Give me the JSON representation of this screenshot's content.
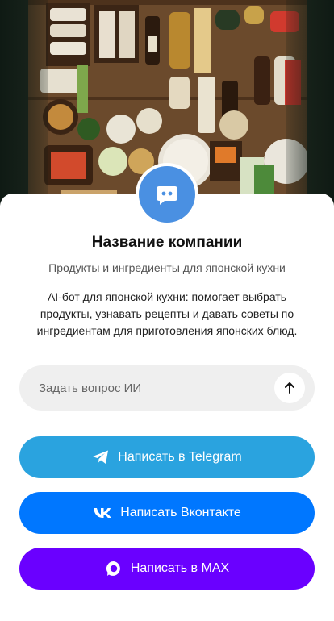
{
  "hero": {
    "image": "japanese-groceries-photo"
  },
  "company": {
    "name": "Название компании",
    "subtitle": "Продукты и ингредиенты для японской кухни",
    "description": "AI-бот для японской кухни: помогает выбрать продукты, узнавать рецепты и давать советы по ингредиентам для приготовления японских блюд."
  },
  "ask": {
    "placeholder": "Задать вопрос ИИ",
    "send_icon": "arrow-up-icon"
  },
  "buttons": [
    {
      "label": "Написать в Telegram",
      "icon": "telegram-icon",
      "color": "#2aa3df"
    },
    {
      "label": "Написать Вконтакте",
      "icon": "vk-icon",
      "color": "#0077ff"
    },
    {
      "label": "Написать в MAX",
      "icon": "max-icon",
      "color": "#6a00ff"
    }
  ],
  "colors": {
    "avatar": "#4a90e2",
    "field_bg": "#efefef"
  }
}
